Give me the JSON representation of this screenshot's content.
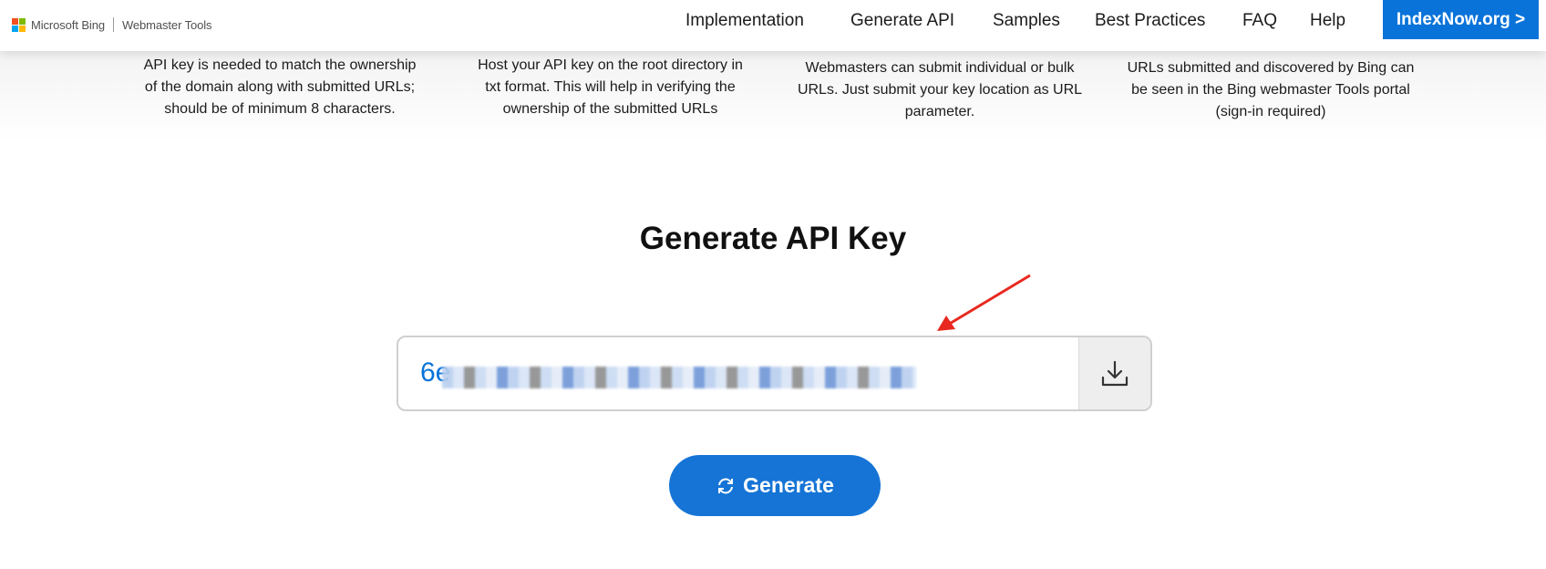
{
  "header": {
    "brand": {
      "name": "Microsoft Bing",
      "product": "Webmaster Tools"
    },
    "logo_colors": [
      "#f25022",
      "#7fba00",
      "#00a4ef",
      "#ffb900"
    ],
    "nav": [
      "Implementation",
      "Generate API",
      "Samples",
      "Best Practices",
      "FAQ",
      "Help"
    ],
    "cta": "IndexNow.org >"
  },
  "features": [
    {
      "lines": [
        "API key is needed to match the ownership",
        "of the domain along with submitted URLs;",
        "should be of minimum 8 characters."
      ]
    },
    {
      "lines": [
        "Host your API key on the root directory in",
        "txt format. This will help in verifying the",
        "ownership of the submitted URLs"
      ]
    },
    {
      "lines": [
        "Webmasters can submit individual or bulk",
        "URLs. Just submit your key location as URL",
        "parameter."
      ]
    },
    {
      "lines": [
        "URLs submitted and discovered by Bing can",
        "be seen in the Bing webmaster Tools portal",
        "(sign-in required)"
      ]
    }
  ],
  "generator": {
    "title": "Generate API Key",
    "key_visible_prefix": "6e",
    "key_redacted": true,
    "download_icon": "download-icon",
    "button_label": "Generate",
    "button_icon": "refresh-icon"
  },
  "colors": {
    "accent": "#0a73d9",
    "annotation_arrow": "#e8281e"
  }
}
